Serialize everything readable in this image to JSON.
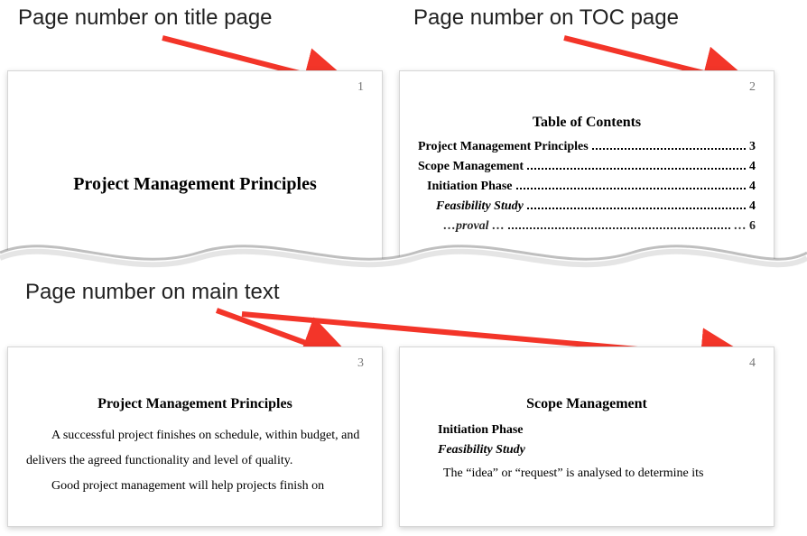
{
  "annotations": {
    "title": "Page number on title page",
    "toc": "Page number on TOC page",
    "main": "Page number on main text"
  },
  "arrow_color": "#f33529",
  "pages": {
    "title": {
      "number": "1",
      "heading": "Project Management Principles"
    },
    "toc": {
      "number": "2",
      "heading": "Table of Contents",
      "items": [
        {
          "label": "Project Management Principles",
          "page": "3",
          "level": 1
        },
        {
          "label": "Scope Management",
          "page": "4",
          "level": 1
        },
        {
          "label": "Initiation Phase",
          "page": "4",
          "level": 2
        },
        {
          "label": "Feasibility Study",
          "page": "4",
          "level": 3
        },
        {
          "label": "…proval …",
          "page": "… 6",
          "level": 4,
          "truncated": true
        }
      ]
    },
    "chapter": {
      "number": "3",
      "heading": "Project Management Principles",
      "para1": "A successful project finishes on schedule, within budget, and delivers the agreed functionality and level of quality.",
      "para2": "Good project management will help projects finish on"
    },
    "scope": {
      "number": "4",
      "heading": "Scope Management",
      "sub1": "Initiation Phase",
      "sub2": "Feasibility Study",
      "para1": "The “idea” or “request” is analysed to determine its"
    }
  }
}
